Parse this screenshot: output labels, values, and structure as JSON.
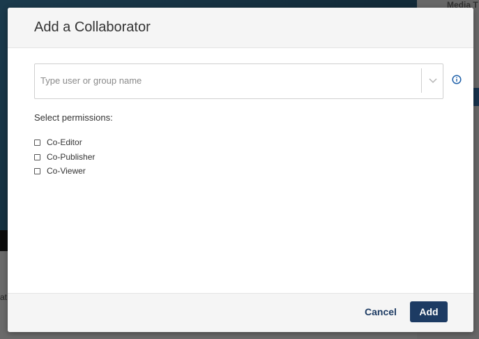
{
  "background": {
    "right_text": "Media T",
    "left_text": "at"
  },
  "modal": {
    "title": "Add a Collaborator",
    "search": {
      "placeholder": "Type user or group name",
      "value": ""
    },
    "permissions_label": "Select permissions:",
    "permissions": [
      {
        "label": "Co-Editor",
        "checked": false
      },
      {
        "label": "Co-Publisher",
        "checked": false
      },
      {
        "label": "Co-Viewer",
        "checked": false
      }
    ],
    "footer": {
      "cancel_label": "Cancel",
      "add_label": "Add"
    }
  },
  "colors": {
    "accent": "#1d3b63",
    "info_icon": "#1d5fa8"
  },
  "icons": {
    "dropdown": "chevron-down-icon",
    "info": "info-icon"
  }
}
